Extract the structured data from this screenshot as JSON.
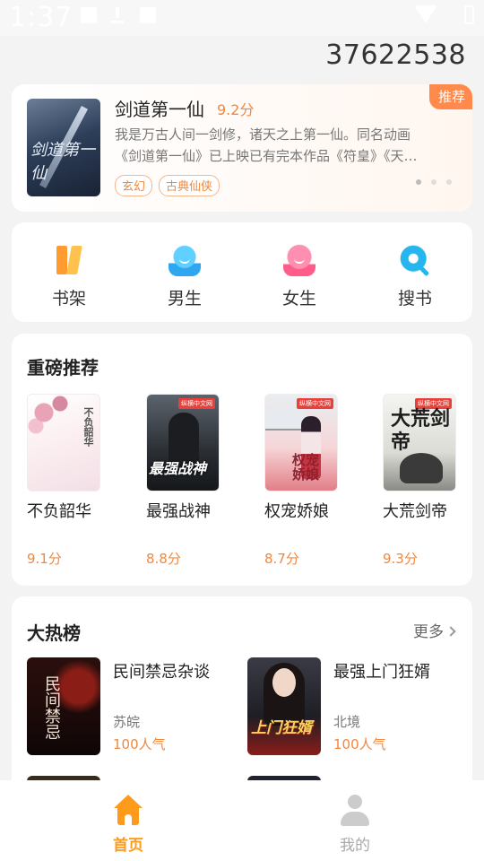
{
  "status_bar": {
    "time": "1:37"
  },
  "header": {
    "user_id": "37622538"
  },
  "banner": {
    "tag": "推荐",
    "cover_title": "剑道第一仙",
    "title": "剑道第一仙",
    "score": "9.2分",
    "description_line1": "我是万古人间一剑修，诸天之上第一仙。同名动画",
    "description_line2": "《剑道第一仙》已上映已有完本作品《符皇》《天…",
    "tags": [
      "玄幻",
      "古典仙侠"
    ]
  },
  "nav": {
    "items": [
      {
        "label": "书架",
        "icon": "bookshelf-icon"
      },
      {
        "label": "男生",
        "icon": "male-icon"
      },
      {
        "label": "女生",
        "icon": "female-icon"
      },
      {
        "label": "搜书",
        "icon": "search-icon"
      }
    ]
  },
  "recommend": {
    "title": "重磅推荐",
    "books": [
      {
        "name": "不负韶华",
        "score": "9.1分",
        "cover_text": "不负韶华"
      },
      {
        "name": "最强战神",
        "score": "8.8分",
        "cover_text": "最强战神"
      },
      {
        "name": "权宠娇娘",
        "score": "8.7分",
        "cover_text": "权宠娇娘"
      },
      {
        "name": "大荒剑帝",
        "score": "9.3分",
        "cover_text": "大荒剑帝"
      }
    ],
    "publisher_badge": "纵横中文网"
  },
  "hot": {
    "title": "大热榜",
    "more_label": "更多",
    "items": [
      {
        "name": "民间禁忌杂谈",
        "author": "苏皖",
        "popularity": "100人气",
        "cover_text": "民间禁忌"
      },
      {
        "name": "最强上门狂婿",
        "author": "北境",
        "popularity": "100人气",
        "cover_text": "上门狂婿"
      }
    ]
  },
  "tabs": {
    "home": "首页",
    "mine": "我的"
  },
  "colors": {
    "accent": "#ff9b1a",
    "score": "#f0883e",
    "tag_bg": "#ff8a4c"
  }
}
